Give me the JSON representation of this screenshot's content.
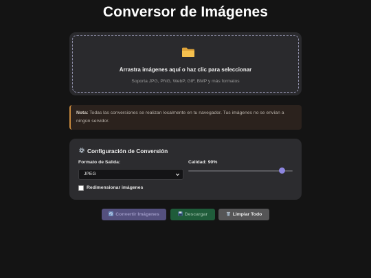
{
  "page": {
    "title": "Conversor de Imágenes"
  },
  "dropzone": {
    "icon": "folder-icon",
    "main_text": "Arrastra imágenes aquí o haz clic para seleccionar",
    "sub_text": "Soporta JPG, PNG, WebP, GIF, BMP y más formatos"
  },
  "note": {
    "label": "Nota:",
    "text": " Todas las conversiones se realizan localmente en tu navegador. Tus imágenes no se envían a ningún servidor."
  },
  "config": {
    "icon": "gear-icon",
    "title": "Configuración de Conversión",
    "format_label": "Formato de Salida:",
    "format_value": "JPEG",
    "quality_label": "Calidad: 90%",
    "quality_value": 90,
    "quality_min": 0,
    "quality_max": 100,
    "resize_label": "Redimensionar imágenes",
    "resize_checked": false
  },
  "actions": {
    "convert_label": "Convertir Imágenes",
    "convert_icon": "refresh-icon",
    "download_label": "Descargar",
    "download_icon": "floppy-disk-icon",
    "clear_label": "Limpiar Todo",
    "clear_icon": "trash-icon"
  },
  "colors": {
    "background": "#141414",
    "accent": "#8d86e0",
    "note_border": "#c98a3e",
    "download_button": "#1f5c3a",
    "convert_button": "#54507e",
    "clear_button": "#555556"
  }
}
